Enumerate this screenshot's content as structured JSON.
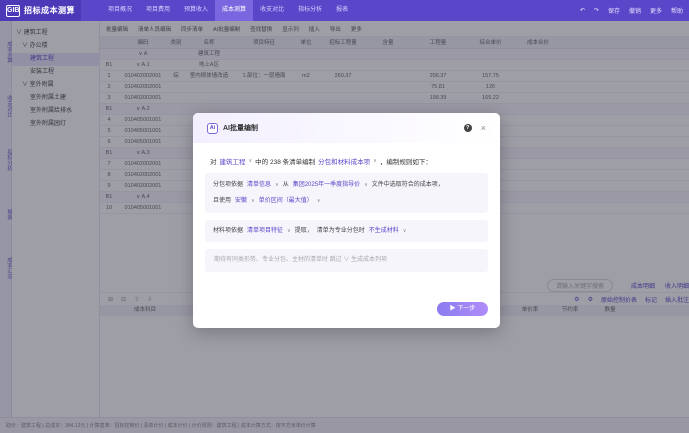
{
  "app": {
    "logo_mark": "GIB",
    "title": "招标成本测算"
  },
  "menu": [
    "项目概况",
    "项目费用",
    "预算收入",
    "成本测算",
    "收支对比",
    "指标分析",
    "报表"
  ],
  "menu_active_index": 3,
  "topright": [
    "↶",
    "↷",
    "保存",
    "撤销",
    "更多",
    "帮助"
  ],
  "rail": [
    "成本测算",
    "收支对比",
    "指标分析",
    "报表",
    "成本汇总"
  ],
  "tree": [
    {
      "label": "∨ 建筑工程",
      "indent": 4
    },
    {
      "label": "∨ 办公楼",
      "indent": 10
    },
    {
      "label": "建筑工程",
      "indent": 18,
      "selected": true
    },
    {
      "label": "安装工程",
      "indent": 18
    },
    {
      "label": "∨ 室外附属",
      "indent": 10
    },
    {
      "label": "室外附属土建",
      "indent": 18
    },
    {
      "label": "室外附属给排水",
      "indent": 18
    },
    {
      "label": "室外附属园灯",
      "indent": 18
    }
  ],
  "toolbar": [
    "批量编辑",
    "清单人员编辑",
    "同步清单",
    "AI批量编制",
    "查找替换",
    "显示列",
    "插入",
    "导出",
    "更多"
  ],
  "grid": {
    "headers": [
      "编码",
      "类别",
      "名称",
      "项目特征",
      "单位",
      "招标工程量",
      "含量",
      "工程量",
      "综合单价",
      "成本合价"
    ],
    "rows": [
      {
        "type": "grp",
        "cells": [
          "",
          "∨ A",
          "",
          "建筑工程",
          "",
          "",
          "",
          "",
          "",
          "",
          ""
        ]
      },
      {
        "type": "row",
        "cells": [
          "B1",
          "∨ A.1",
          "",
          "地上A区",
          "",
          "",
          "",
          "",
          "",
          "",
          ""
        ]
      },
      {
        "type": "row",
        "cells": [
          "1",
          "010402002001",
          "综",
          "室内砌体墙改造",
          "1.部位：一层墙面",
          "m2",
          "260.37",
          "",
          "206.37",
          "157.75",
          ""
        ]
      },
      {
        "type": "row",
        "cells": [
          "2",
          "010402002001",
          "",
          "",
          "",
          "",
          "",
          "",
          "75.81",
          "126",
          ""
        ]
      },
      {
        "type": "row",
        "cells": [
          "3",
          "010402002001",
          "",
          "",
          "",
          "",
          "",
          "",
          "198.39",
          "165.22",
          ""
        ]
      },
      {
        "type": "grp",
        "cells": [
          "B1",
          "∨ A.2",
          "",
          "",
          "",
          "",
          "",
          "",
          "",
          "",
          ""
        ]
      },
      {
        "type": "row",
        "cells": [
          "4",
          "010405001001",
          "",
          "",
          "",
          "",
          "",
          "",
          "1596.49",
          "302.67",
          ""
        ]
      },
      {
        "type": "row",
        "cells": [
          "5",
          "010405001001",
          "",
          "",
          "",
          "",
          "",
          "",
          "5.948",
          "7424.84",
          ""
        ]
      },
      {
        "type": "row",
        "cells": [
          "6",
          "010405001001",
          "",
          "",
          "",
          "",
          "",
          "",
          "4.64",
          "720.86",
          ""
        ]
      },
      {
        "type": "grp",
        "cells": [
          "B1",
          "∨ A.3",
          "",
          "",
          "",
          "",
          "",
          "",
          "",
          "",
          ""
        ]
      },
      {
        "type": "row",
        "cells": [
          "7",
          "010402002001",
          "",
          "",
          "",
          "",
          "",
          "",
          "206.37",
          "157.75",
          ""
        ]
      },
      {
        "type": "row",
        "cells": [
          "8",
          "010402002001",
          "",
          "",
          "",
          "",
          "",
          "",
          "75.81",
          "126",
          ""
        ]
      },
      {
        "type": "row",
        "cells": [
          "9",
          "010402002001",
          "",
          "",
          "",
          "",
          "",
          "",
          "198.39",
          "165.22",
          ""
        ]
      },
      {
        "type": "grp",
        "cells": [
          "B1",
          "∨ A.4",
          "",
          "",
          "",
          "",
          "",
          "",
          "",
          "",
          ""
        ]
      },
      {
        "type": "row",
        "cells": [
          "10",
          "010405001001",
          "",
          "",
          "",
          "",
          "",
          "",
          "1596.49",
          "302.67",
          ""
        ]
      }
    ]
  },
  "lower": {
    "tabs": [
      "成本明细",
      "收入明细"
    ],
    "search_placeholder": "请输入关键字搜索",
    "tools": [
      "⊞",
      "⊟",
      "⇧",
      "⇩"
    ],
    "right_tools": [
      "⚙",
      "⚙",
      "原始控制价表",
      "标记",
      "插入批注"
    ],
    "headers": [
      "成本科目",
      "",
      "",
      "",
      "",
      "",
      "",
      "",
      "含量",
      "单价率",
      "节约率",
      "数量"
    ]
  },
  "statusbar": "取价：建筑工程 | 总成本：384.12元 | 计算基准：招标控制价 | 清单计价 | 成本计价 | 计价规则：建筑工程 | 成本计算方式：按平方米单价计算",
  "modal": {
    "title": "AI批量编制",
    "line1_prefix": "对",
    "line1_scope": "建筑工程",
    "line1_mid": "中的 238 条清单编制",
    "line1_target": "分包和材料成本项",
    "line1_suffix": "，编制规则如下：",
    "rule1_label": "分包项依据",
    "rule1_src": "清单信息",
    "rule1_from": "从",
    "rule1_db": "集团2025年一季度指导价",
    "rule1_tail": "文件中选取符合的成本项，",
    "rule1b_prefix": "且使用",
    "rule1b_region": "安徽",
    "rule1b_price": "单价区间（最大值）",
    "rule2_label": "材料项依据",
    "rule2_src": "清单项目特征",
    "rule2_mid": "提取，",
    "rule2_cond": "清单为专业分包时",
    "rule2_act": "不生成材料",
    "prompt": "期待有同类形势、专业分包、主材的清单时 跳过 ∨ 生成成本列项",
    "next_button": "▶ 下一步"
  },
  "colors": {
    "brand": "#5a46c8",
    "accent": "#8b7cf0"
  }
}
